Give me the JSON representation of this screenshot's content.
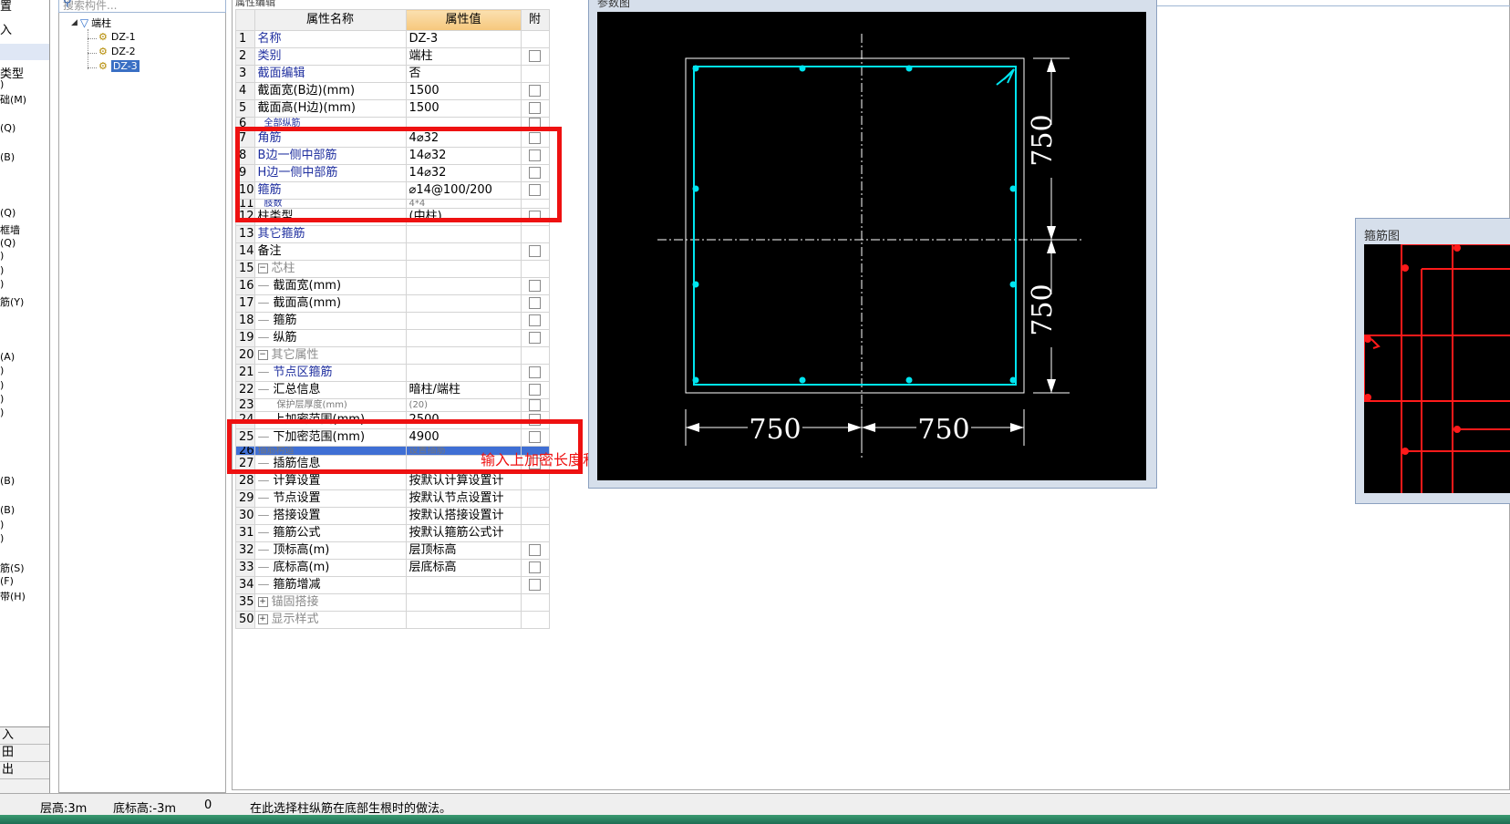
{
  "left_strip": {
    "fragments": [
      "置",
      "入",
      "类型",
      ")",
      "础(M)",
      "(Q)",
      "(B)",
      "(Q)",
      "框墙",
      "(Q)",
      ")",
      ")",
      ")",
      "筋(Y)",
      "(A)",
      ")",
      ")",
      ")",
      ")",
      "(B)",
      "(B)",
      ")",
      ")",
      "筋(S)",
      "(F)",
      "带(H)"
    ],
    "bottom_items": [
      "入",
      "田",
      "出"
    ]
  },
  "search": {
    "placeholder": "搜索构件..."
  },
  "tree": {
    "root": "端柱",
    "items": [
      "DZ-1",
      "DZ-2",
      "DZ-3"
    ],
    "selected": "DZ-3"
  },
  "table": {
    "headers": {
      "name": "属性名称",
      "value": "属性值",
      "attach": "附"
    },
    "rows": [
      {
        "num": "1",
        "name": "名称",
        "value": "DZ-3",
        "style": "blue",
        "cb": false
      },
      {
        "num": "2",
        "name": "类别",
        "value": "端柱",
        "style": "blue",
        "cb": true
      },
      {
        "num": "3",
        "name": "截面编辑",
        "value": "否",
        "style": "blue",
        "cb": false
      },
      {
        "num": "4",
        "name": "截面宽(B边)(mm)",
        "value": "1500",
        "style": "normal",
        "cb": true
      },
      {
        "num": "5",
        "name": "截面高(H边)(mm)",
        "value": "1500",
        "style": "normal",
        "cb": true
      },
      {
        "num": "6",
        "name": "全部纵筋",
        "value": "",
        "style": "clip",
        "cb": true
      },
      {
        "num": "7",
        "name": "角筋",
        "value": "4⌀32",
        "style": "blue",
        "cb": true
      },
      {
        "num": "8",
        "name": "B边一侧中部筋",
        "value": "14⌀32",
        "style": "blue",
        "cb": true
      },
      {
        "num": "9",
        "name": "H边一侧中部筋",
        "value": "14⌀32",
        "style": "blue",
        "cb": true
      },
      {
        "num": "10",
        "name": "箍筋",
        "value": "⌀14@100/200",
        "style": "blue",
        "cb": true
      },
      {
        "num": "11",
        "name": "肢数",
        "value": "4*4",
        "style": "clip",
        "cb": false
      },
      {
        "num": "12",
        "name": "柱类型",
        "value": "(中柱)",
        "style": "normal",
        "cb": true
      },
      {
        "num": "13",
        "name": "其它箍筋",
        "value": "",
        "style": "blue",
        "cb": false
      },
      {
        "num": "14",
        "name": "备注",
        "value": "",
        "style": "normal",
        "cb": true
      },
      {
        "num": "15",
        "name": "芯柱",
        "value": "",
        "style": "group",
        "cb": false
      },
      {
        "num": "16",
        "name": "截面宽(mm)",
        "value": "",
        "style": "sub",
        "cb": true
      },
      {
        "num": "17",
        "name": "截面高(mm)",
        "value": "",
        "style": "sub",
        "cb": true
      },
      {
        "num": "18",
        "name": "箍筋",
        "value": "",
        "style": "sub",
        "cb": true
      },
      {
        "num": "19",
        "name": "纵筋",
        "value": "",
        "style": "sub",
        "cb": true
      },
      {
        "num": "20",
        "name": "其它属性",
        "value": "",
        "style": "group",
        "cb": false
      },
      {
        "num": "21",
        "name": "节点区箍筋",
        "value": "",
        "style": "subblue",
        "cb": true
      },
      {
        "num": "22",
        "name": "汇总信息",
        "value": "暗柱/端柱",
        "style": "sub",
        "cb": true
      },
      {
        "num": "23",
        "name": "保护层厚度(mm)",
        "value": "(20)",
        "style": "clip",
        "cb": true
      },
      {
        "num": "24",
        "name": "上加密范围(mm)",
        "value": "2500",
        "style": "sub",
        "cb": true
      },
      {
        "num": "25",
        "name": "下加密范围(mm)",
        "value": "4900",
        "style": "sub",
        "cb": true
      },
      {
        "num": "26",
        "name": "插筋构造",
        "value": "设置插筋",
        "style": "hl",
        "cb": false
      },
      {
        "num": "27",
        "name": "插筋信息",
        "value": "",
        "style": "sub",
        "cb": true
      },
      {
        "num": "28",
        "name": "计算设置",
        "value": "按默认计算设置计",
        "style": "sub",
        "cb": false
      },
      {
        "num": "29",
        "name": "节点设置",
        "value": "按默认节点设置计",
        "style": "sub",
        "cb": false
      },
      {
        "num": "30",
        "name": "搭接设置",
        "value": "按默认搭接设置计",
        "style": "sub",
        "cb": false
      },
      {
        "num": "31",
        "name": "箍筋公式",
        "value": "按默认箍筋公式计",
        "style": "sub",
        "cb": false
      },
      {
        "num": "32",
        "name": "顶标高(m)",
        "value": "层顶标高",
        "style": "sub",
        "cb": true
      },
      {
        "num": "33",
        "name": "底标高(m)",
        "value": "层底标高",
        "style": "sub",
        "cb": true
      },
      {
        "num": "34",
        "name": "箍筋增减",
        "value": "",
        "style": "sub",
        "cb": true
      },
      {
        "num": "35",
        "name": "锚固搭接",
        "value": "",
        "style": "groupplus",
        "cb": false
      },
      {
        "num": "50",
        "name": "显示样式",
        "value": "",
        "style": "groupplus",
        "cb": false
      }
    ]
  },
  "annotation": "输入上加密长度和下加密长度。",
  "param_diagram": {
    "title": "参数图",
    "dims": {
      "top": "750",
      "bottom": "750",
      "left": "750",
      "right": "750"
    },
    "colors": {
      "bg": "#000000",
      "rebar": "#00e5f0",
      "outline": "#ffffff"
    }
  },
  "stirrup_diagram": {
    "title": "箍筋图",
    "colors": {
      "bg": "#000000",
      "line": "#ff1a1a"
    }
  },
  "status": {
    "floor_height": "层高:3m",
    "bottom_elev": "底标高:-3m",
    "zero": "0",
    "hint": "在此选择柱纵筋在底部生根时的做法。"
  }
}
